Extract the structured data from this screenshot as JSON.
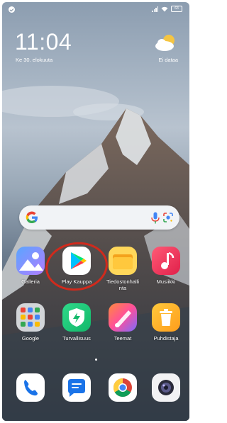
{
  "status_bar": {
    "battery": "63"
  },
  "clock": {
    "time": "11:04",
    "date": "Ke 30. elokuuta"
  },
  "weather": {
    "label": "Ei dataa"
  },
  "apps": [
    {
      "label": "Galleria"
    },
    {
      "label": "Play Kauppa"
    },
    {
      "label": "Tiedostonhallinta"
    },
    {
      "label": "Musiikki"
    },
    {
      "label": "Google"
    },
    {
      "label": "Turvallisuus"
    },
    {
      "label": "Teemat"
    },
    {
      "label": "Puhdistaja"
    }
  ],
  "dock": [
    {
      "icon": "phone-icon"
    },
    {
      "icon": "messages-icon"
    },
    {
      "icon": "chrome-icon"
    },
    {
      "icon": "camera-icon"
    }
  ],
  "colors": {
    "highlight_circle": "#d02a1c"
  }
}
